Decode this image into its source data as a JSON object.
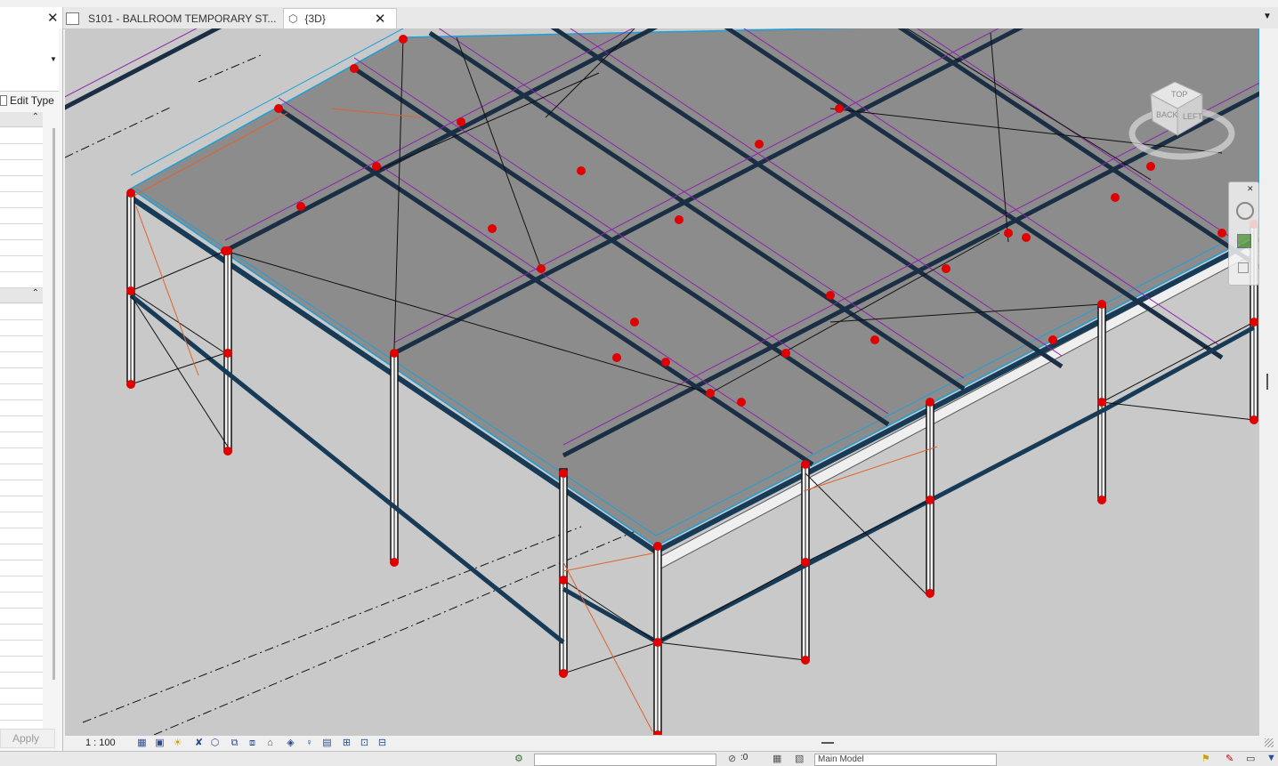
{
  "tabs": [
    {
      "label": "S101 - BALLROOM TEMPORARY ST...",
      "icon": "sheet-icon"
    },
    {
      "label": "{3D}",
      "icon": "3d-view-icon",
      "active": true
    }
  ],
  "properties": {
    "edit_type_label": "Edit Type",
    "apply_label": "Apply"
  },
  "viewcube": {
    "top_label": "TOP",
    "back_label": "BACK",
    "left_label": "LEFT"
  },
  "view_control_bar": {
    "scale": "1 : 100"
  },
  "statusbar": {
    "model_selector": "Main Model",
    "design_option_value": ":0"
  },
  "colors": {
    "accent": "#1f4e79",
    "beam": "#173a56",
    "hotspot": "#e00000",
    "roof": "#8c8c8c",
    "viewport_bg": "#c9c9c9"
  }
}
